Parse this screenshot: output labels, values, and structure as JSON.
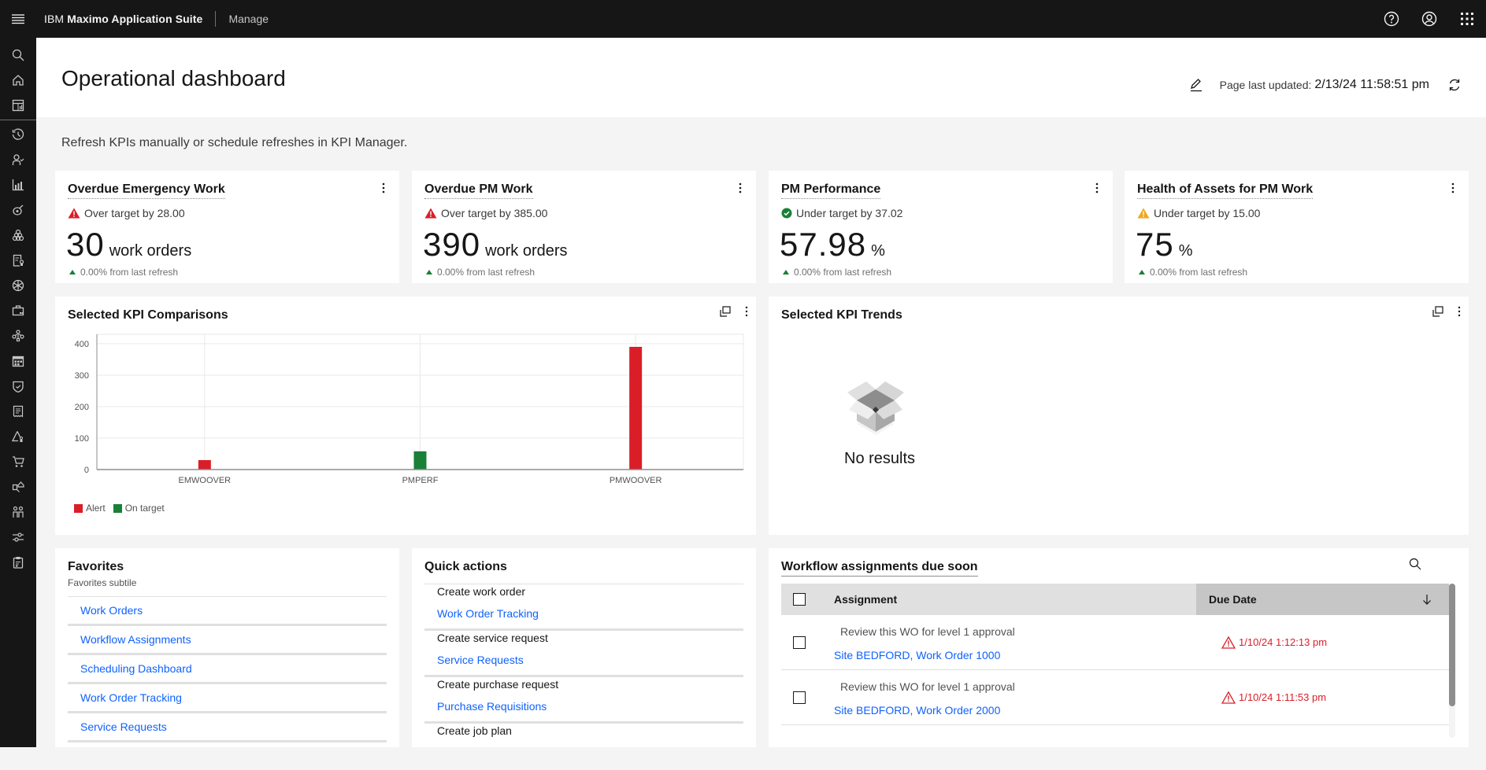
{
  "header": {
    "brand_prefix": "IBM",
    "brand_name": "Maximo Application Suite",
    "app_name": "Manage",
    "icons": [
      "help-icon",
      "user-avatar-icon",
      "app-switcher-icon"
    ]
  },
  "sidebar": {
    "items": [
      {
        "name": "search",
        "icon": "search-icon"
      },
      {
        "name": "home",
        "icon": "home-icon"
      },
      {
        "name": "dashboard",
        "icon": "dashboard-icon"
      },
      {
        "name": "recent",
        "icon": "history-icon"
      },
      {
        "name": "people",
        "icon": "user-check-icon"
      },
      {
        "name": "reports",
        "icon": "bar-chart-icon"
      },
      {
        "name": "assets",
        "icon": "asset-icon"
      },
      {
        "name": "inventory",
        "icon": "inventory-icon"
      },
      {
        "name": "work-orders",
        "icon": "document-certificate-icon"
      },
      {
        "name": "service",
        "icon": "wheel-icon"
      },
      {
        "name": "job-plans",
        "icon": "toolbox-icon"
      },
      {
        "name": "hierarchy",
        "icon": "hierarchy-icon"
      },
      {
        "name": "calendar",
        "icon": "calendar-icon"
      },
      {
        "name": "safety",
        "icon": "shield-check-icon"
      },
      {
        "name": "invoices",
        "icon": "receipt-icon"
      },
      {
        "name": "hazards",
        "icon": "warning-person-icon"
      },
      {
        "name": "purchasing",
        "icon": "cart-icon"
      },
      {
        "name": "delivery",
        "icon": "delivery-icon"
      },
      {
        "name": "users",
        "icon": "group-icon"
      },
      {
        "name": "settings",
        "icon": "sliders-icon"
      },
      {
        "name": "tasks",
        "icon": "clipboard-icon"
      }
    ]
  },
  "page": {
    "title": "Operational dashboard",
    "last_updated_label": "Page last updated:",
    "last_updated_value": "2/13/24 11:58:51 pm",
    "subtitle": "Refresh KPIs manually or schedule refreshes in KPI Manager."
  },
  "kpis": [
    {
      "title": "Overdue Emergency Work",
      "status": "Over target by 28.00",
      "status_type": "alert",
      "value": "30",
      "unit": "work orders",
      "delta": "0.00% from last refresh"
    },
    {
      "title": "Overdue PM Work",
      "status": "Over target by 385.00",
      "status_type": "alert",
      "value": "390",
      "unit": "work orders",
      "delta": "0.00% from last refresh"
    },
    {
      "title": "PM Performance",
      "status": "Under target by 37.02",
      "status_type": "ok",
      "value": "57.98",
      "unit": "%",
      "delta": "0.00% from last refresh"
    },
    {
      "title": "Health of Assets for PM Work",
      "status": "Under target by 15.00",
      "status_type": "warning",
      "value": "75",
      "unit": "%",
      "delta": "0.00% from last refresh"
    }
  ],
  "comparisons": {
    "title": "Selected KPI Comparisons"
  },
  "chart_data": {
    "type": "bar",
    "title": "Selected KPI Comparisons",
    "categories": [
      "EMWOOVER",
      "PMPERF",
      "PMWOOVER"
    ],
    "values": [
      30,
      57.98,
      390
    ],
    "status": [
      "Alert",
      "On target",
      "Alert"
    ],
    "yticks": [
      0,
      100,
      200,
      300,
      400
    ],
    "ylim": [
      0,
      430
    ],
    "xlabel": "",
    "ylabel": "",
    "grid": true,
    "legend": [
      {
        "label": "Alert",
        "color": "#da1e28"
      },
      {
        "label": "On target",
        "color": "#198038"
      }
    ],
    "legend_position": "bottom-left"
  },
  "trends": {
    "title": "Selected KPI Trends",
    "empty_text": "No results"
  },
  "favorites": {
    "title": "Favorites",
    "subtitle": "Favorites subtile",
    "items": [
      "Work Orders",
      "Workflow Assignments",
      "Scheduling Dashboard",
      "Work Order Tracking",
      "Service Requests"
    ]
  },
  "quick_actions": {
    "title": "Quick actions",
    "items": [
      {
        "label": "Create work order",
        "link": "Work Order Tracking"
      },
      {
        "label": "Create service request",
        "link": "Service Requests"
      },
      {
        "label": "Create purchase request",
        "link": "Purchase Requisitions"
      },
      {
        "label": "Create job plan",
        "link": ""
      }
    ]
  },
  "workflow": {
    "title": "Workflow assignments due soon",
    "columns": {
      "assignment": "Assignment",
      "due_date": "Due Date"
    },
    "rows": [
      {
        "description": "Review this WO for level 1 approval",
        "link": "Site BEDFORD, Work Order 1000",
        "due": "1/10/24 1:12:13 pm"
      },
      {
        "description": "Review this WO for level 1 approval",
        "link": "Site BEDFORD, Work Order 2000",
        "due": "1/10/24 1:11:53 pm"
      }
    ]
  },
  "colors": {
    "alert": "#da1e28",
    "on_target": "#198038",
    "warning": "#f1c21b",
    "link": "#0f62fe",
    "header_bg": "#161616"
  }
}
